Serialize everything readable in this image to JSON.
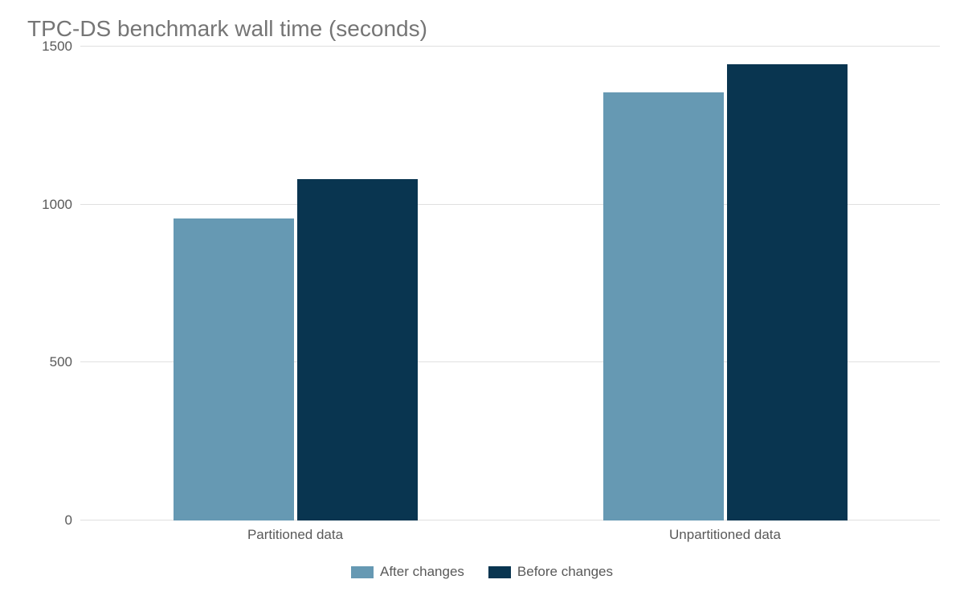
{
  "chart_data": {
    "type": "bar",
    "title": "TPC-DS benchmark wall time (seconds)",
    "categories": [
      "Partitioned data",
      "Unpartitioned data"
    ],
    "series": [
      {
        "name": "After changes",
        "color": "#6699b3",
        "values": [
          955,
          1355
        ]
      },
      {
        "name": "Before changes",
        "color": "#093550",
        "values": [
          1080,
          1445
        ]
      }
    ],
    "ylim": [
      0,
      1500
    ],
    "yticks": [
      0,
      500,
      1000,
      1500
    ],
    "xlabel": "",
    "ylabel": ""
  }
}
